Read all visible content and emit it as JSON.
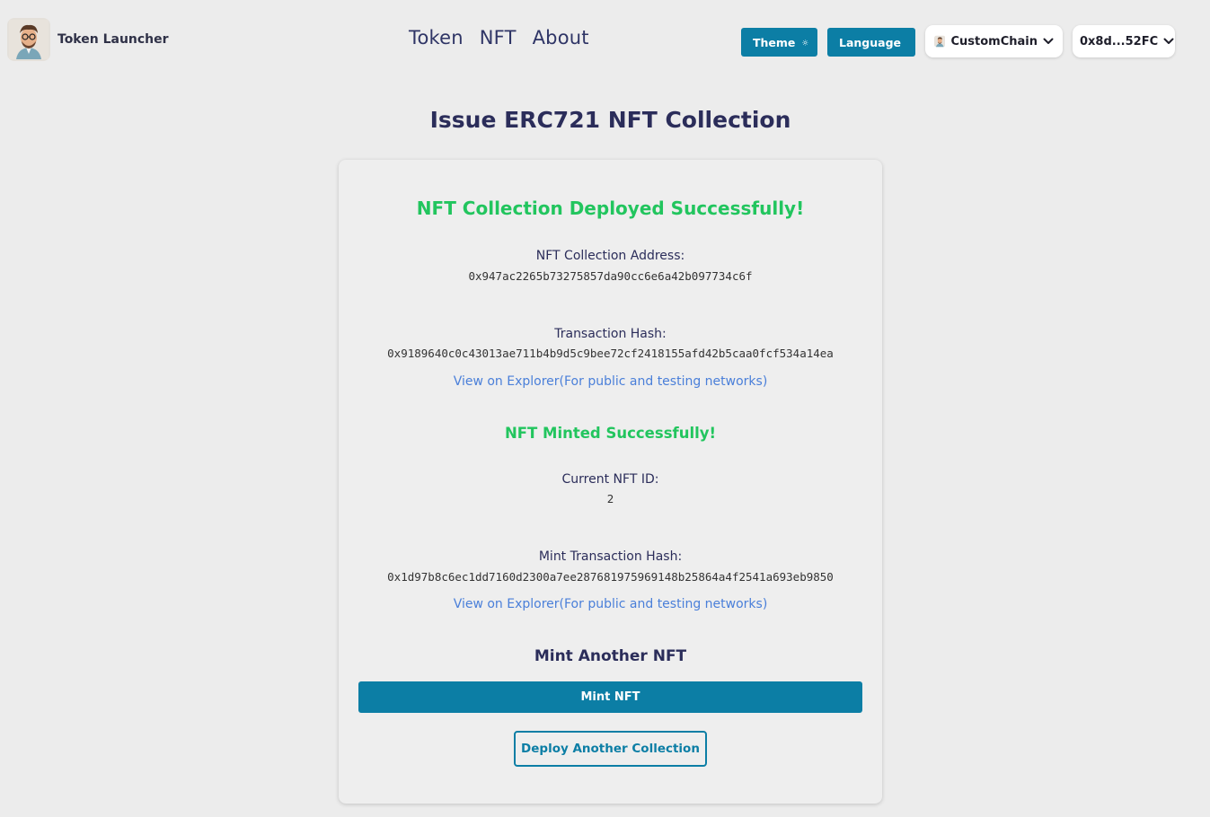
{
  "app": {
    "name": "Token Launcher"
  },
  "nav": {
    "items": [
      "Token",
      "NFT",
      "About"
    ]
  },
  "controls": {
    "theme_label": "Theme",
    "language_label": "Language",
    "chain_label": "CustomChain",
    "wallet_label": "0x8d...52FC"
  },
  "page": {
    "title": "Issue ERC721 NFT Collection"
  },
  "deploy": {
    "success": "NFT Collection Deployed Successfully!",
    "address_label": "NFT Collection Address:",
    "address_value": "0x947ac2265b73275857da90cc6e6a42b097734c6f",
    "tx_label": "Transaction Hash:",
    "tx_value": "0x9189640c0c43013ae711b4b9d5c9bee72cf2418155afd42b5caa0fcf534a14ea",
    "explorer_link": "View on Explorer(For public and testing networks)"
  },
  "mint": {
    "success": "NFT Minted Successfully!",
    "id_label": "Current NFT ID:",
    "id_value": "2",
    "tx_label": "Mint Transaction Hash:",
    "tx_value": "0x1d97b8c6ec1dd7160d2300a7ee287681975969148b25864a4f2541a693eb9850",
    "explorer_link": "View on Explorer(For public and testing networks)",
    "another_heading": "Mint Another NFT",
    "mint_button": "Mint NFT",
    "deploy_another_button": "Deploy Another Collection"
  },
  "colors": {
    "accent": "#0c7ea5",
    "success": "#22c55e",
    "link": "#4a7fd9",
    "text": "#2b2d5a",
    "background": "#ececec"
  },
  "icons": {
    "theme": "sun-icon",
    "language": "globe-icon",
    "chevron": "chevron-down-icon",
    "logo": "avatar-logo"
  }
}
